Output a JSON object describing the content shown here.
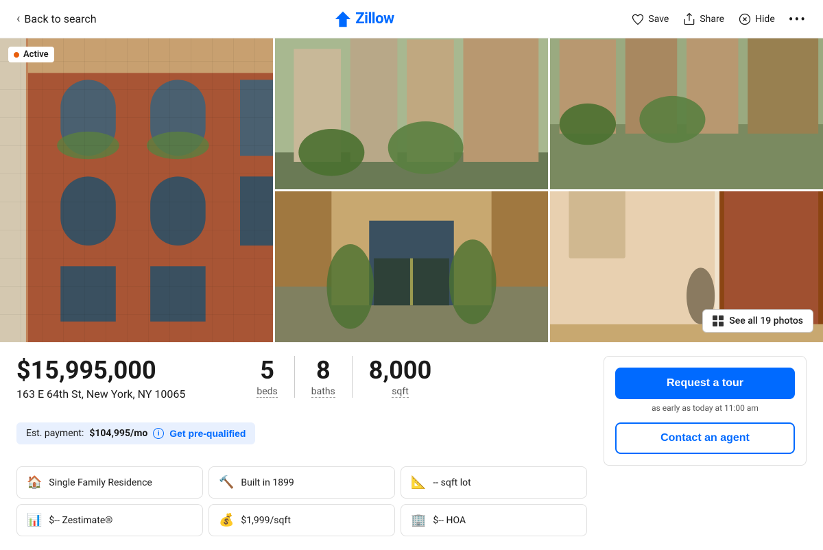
{
  "header": {
    "back_label": "Back to search",
    "logo_text": "Zillow",
    "save_label": "Save",
    "share_label": "Share",
    "hide_label": "Hide"
  },
  "listing": {
    "status": "Active",
    "price": "$15,995,000",
    "address": "163 E 64th St, New York, NY 10065",
    "beds": "5",
    "beds_label": "beds",
    "baths": "8",
    "baths_label": "baths",
    "sqft": "8,000",
    "sqft_label": "sqft",
    "est_payment_label": "Est. payment:",
    "est_payment_value": "$104,995/mo",
    "get_prequalified": "Get pre-qualified",
    "photos_count": "See all 19 photos",
    "details": [
      {
        "icon": "🏠",
        "label": "Single Family Residence"
      },
      {
        "icon": "🔨",
        "label": "Built in 1899"
      },
      {
        "icon": "📐",
        "label": "-- sqft lot"
      },
      {
        "icon": "📊",
        "label": "$-- Zestimate®"
      },
      {
        "icon": "💰",
        "label": "$1,999/sqft"
      },
      {
        "icon": "🏢",
        "label": "$-- HOA"
      }
    ]
  },
  "tour": {
    "request_label": "Request a tour",
    "subtitle": "as early as today at 11:00 am",
    "contact_label": "Contact an agent"
  }
}
